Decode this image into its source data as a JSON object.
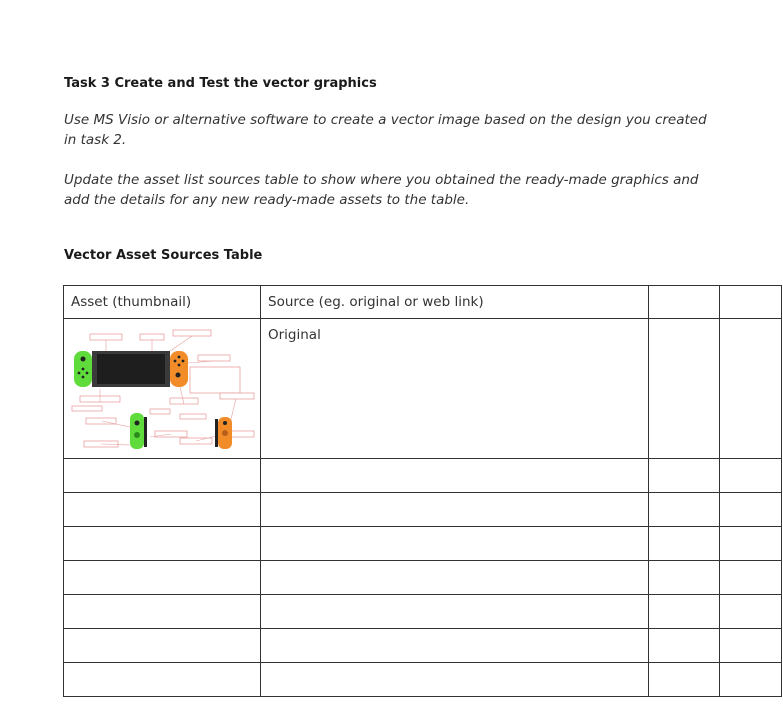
{
  "document": {
    "task_heading": "Task 3 Create and Test the vector graphics",
    "paragraph_1": "Use MS Visio or alternative software to create a vector image based on the design you created in task 2.",
    "paragraph_2": "Update the asset list sources table to show where you obtained the ready-made graphics and add the details for any new ready-made assets to the table.",
    "table_heading": "Vector Asset Sources Table"
  },
  "table": {
    "headers": [
      "Asset (thumbnail)",
      "Source (eg. original or web link)",
      "",
      ""
    ],
    "rows": [
      {
        "thumbnail": "console-diagram-thumbnail",
        "source": "Original",
        "col3": "",
        "col4": ""
      },
      {
        "thumbnail": "",
        "source": "",
        "col3": "",
        "col4": ""
      },
      {
        "thumbnail": "",
        "source": "",
        "col3": "",
        "col4": ""
      },
      {
        "thumbnail": "",
        "source": "",
        "col3": "",
        "col4": ""
      },
      {
        "thumbnail": "",
        "source": "",
        "col3": "",
        "col4": ""
      },
      {
        "thumbnail": "",
        "source": "",
        "col3": "",
        "col4": ""
      },
      {
        "thumbnail": "",
        "source": "",
        "col3": "",
        "col4": ""
      },
      {
        "thumbnail": "",
        "source": "",
        "col3": "",
        "col4": ""
      }
    ]
  },
  "colors": {
    "left_joycon": "#5fdc3c",
    "right_joycon": "#f28c28",
    "console_body": "#3a3a3a",
    "annotation_box": "#e8a0a0"
  }
}
